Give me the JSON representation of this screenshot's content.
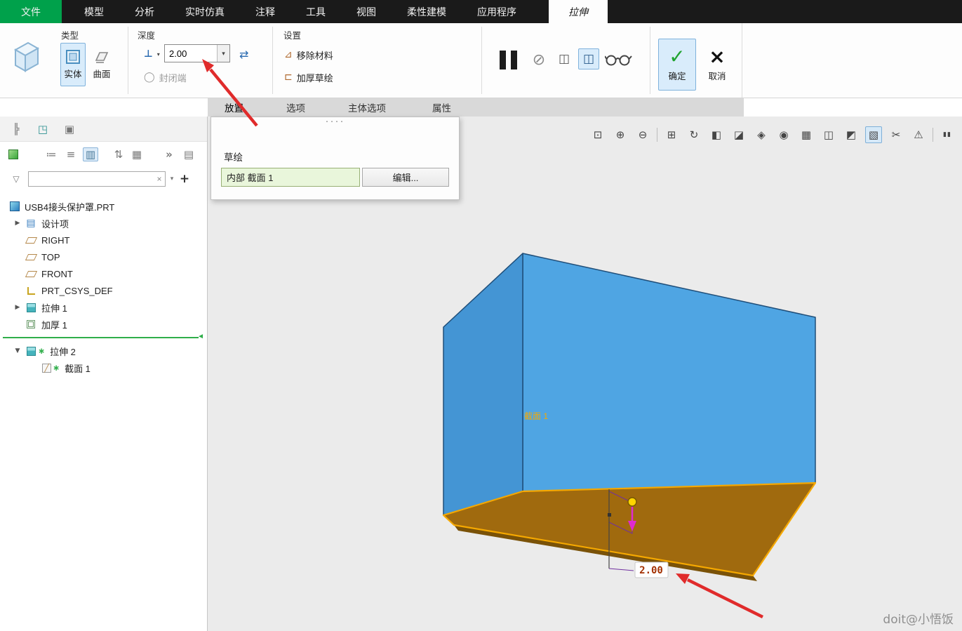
{
  "menubar": {
    "tabs": [
      {
        "label": "文件"
      },
      {
        "label": "模型"
      },
      {
        "label": "分析"
      },
      {
        "label": "实时仿真"
      },
      {
        "label": "注释"
      },
      {
        "label": "工具"
      },
      {
        "label": "视图"
      },
      {
        "label": "柔性建模"
      },
      {
        "label": "应用程序"
      },
      {
        "label": "拉伸"
      }
    ]
  },
  "ribbon": {
    "type_group": {
      "title": "类型",
      "solid": "实体",
      "surface": "曲面"
    },
    "depth_group": {
      "title": "深度",
      "depth_value": "2.00",
      "closed_end": "封闭端"
    },
    "settings_group": {
      "title": "设置",
      "remove_material": "移除材料",
      "thicken_sketch": "加厚草绘"
    },
    "confirm_group": {
      "ok": "确定",
      "cancel": "取消"
    }
  },
  "tabstrip": {
    "tabs": [
      "放置",
      "选项",
      "主体选项",
      "属性"
    ]
  },
  "placement_panel": {
    "sketch_label": "草绘",
    "sketch_ref": "内部 截面 1",
    "edit": "编辑..."
  },
  "sidebar": {
    "tree": [
      {
        "label": "USB4接头保护罩.PRT"
      },
      {
        "expander": "▶",
        "label": "设计项"
      },
      {
        "label": "RIGHT"
      },
      {
        "label": "TOP"
      },
      {
        "label": "FRONT"
      },
      {
        "label": "PRT_CSYS_DEF"
      },
      {
        "expander": "▶",
        "label": "拉伸 1"
      },
      {
        "label": "加厚 1"
      },
      {
        "expander": "▼",
        "mark": "∗",
        "label": "拉伸 2"
      },
      {
        "mark": "∗",
        "label": "截面 1"
      }
    ]
  },
  "viewport": {
    "section_label": "截面 1",
    "dimension_value": "2.00",
    "watermark": "doit@小悟饭"
  },
  "icons": {
    "zoom_window": "⊡",
    "zoom_in": "⊕",
    "zoom_out": "⊖",
    "refit": "⊞",
    "repaint": "↻",
    "shaded": "◧",
    "display_style": "◪",
    "datum": "◈",
    "spin": "◉",
    "view_manager": "▦",
    "perspective": "◫",
    "section": "◩",
    "dragger": "▧",
    "trim": "✂",
    "alert": "⚠",
    "pause_small": "▮▮",
    "clipped": "▯",
    "tree_sidebar": "╠",
    "layers": "◳",
    "tree_settings": "▣",
    "list_a": "≔",
    "list_b": "≡",
    "columns": "▥",
    "sort": "⇅",
    "grid": "▦",
    "chevrons": "»",
    "report": "▤",
    "funnel": "▽",
    "caret": "▾",
    "plus": "+",
    "clear": "×",
    "ok_check": "✓",
    "cancel_x": "×",
    "no_preview": "⊘",
    "preview_box": "◫",
    "depth_type": "⊥",
    "flip": "⇄",
    "closed_end": "◯",
    "remove_material": "⊿",
    "thicken": "⊏",
    "grip": "····"
  },
  "colors": {
    "accent_green": "#00a14b",
    "selection_blue": "#d9ecfb",
    "wall_blue": "#4fa5e3",
    "floor_brown": "#a06a0e",
    "edge_orange": "#f5a800",
    "arrow_red": "#e02b2b",
    "dim_magenta": "#e02ad0"
  }
}
